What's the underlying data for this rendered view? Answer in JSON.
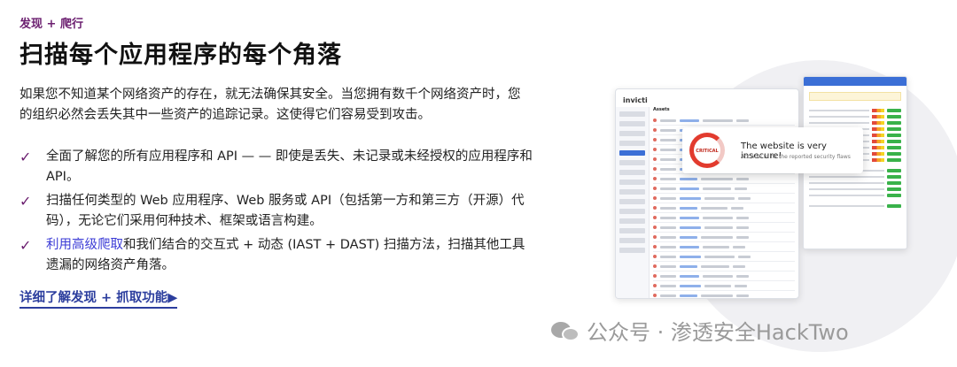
{
  "eyebrow": "发现 + 爬行",
  "title": "扫描每个应用程序的每个角落",
  "intro": "如果您不知道某个网络资产的存在，就无法确保其安全。当您拥有数千个网络资产时，您的组织必然会丢失其中一些资产的追踪记录。这使得它们容易受到攻击。",
  "checklist": [
    {
      "text": "全面了解您的所有应用程序和 API — — 即使是丢失、未记录或未经授权的应用程序和 API。"
    },
    {
      "text": "扫描任何类型的 Web 应用程序、Web 服务或 API（包括第一方和第三方（开源）代码），无论它们采用何种技术、框架或语言构建。"
    },
    {
      "link": "利用高级爬取",
      "text": "和我们结合的交互式 + 动态 (IAST + DAST) 扫描方法，扫描其他工具遗漏的网络资产角落。"
    }
  ],
  "cta": "详细了解发现 + 抓取功能▶",
  "mockup": {
    "logo": "invicti",
    "main_title": "Assets",
    "alert_title": "The website is very insecure!",
    "alert_sub": "Act now to fix the reported security flaws",
    "gauge_label": "CRITICAL"
  },
  "watermark": "公众号 · 渗透安全HackTwo",
  "icons": {
    "check": "check-icon",
    "wechat": "wechat-icon"
  },
  "colors": {
    "accent": "#6b1e6f",
    "link": "#2c3e9e",
    "critical": "#e23b2e"
  }
}
